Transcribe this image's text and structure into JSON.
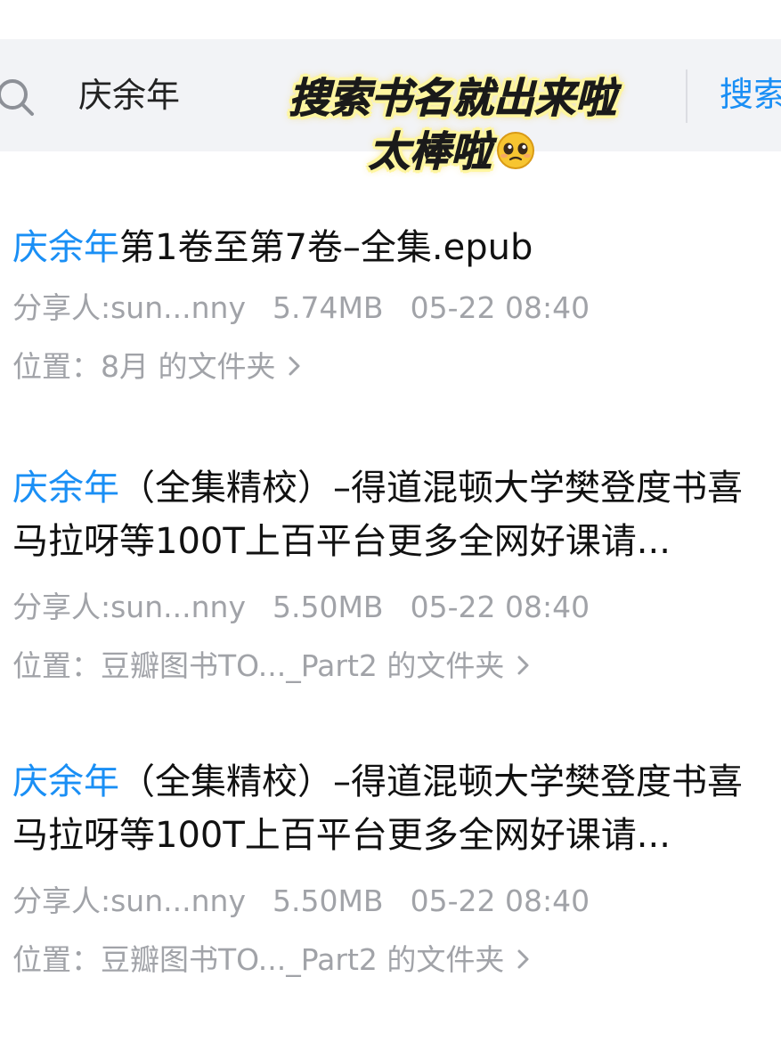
{
  "search": {
    "query": "庆余年",
    "button_label": "搜索"
  },
  "caption": {
    "line1": "搜索书名就出来啦",
    "line2": "太棒啦"
  },
  "results": [
    {
      "title_highlight": "庆余年",
      "title_rest": "第1卷至第7卷–全集.epub",
      "sharer": "分享人:sun...nny",
      "size": "5.74MB",
      "time": "05-22 08:40",
      "location": "位置：8月 的文件夹"
    },
    {
      "title_highlight": "庆余年",
      "title_rest": "（全集精校）–得道混顿大学樊登度书喜马拉呀等100T上百平台更多全网好课请...",
      "sharer": "分享人:sun...nny",
      "size": "5.50MB",
      "time": "05-22 08:40",
      "location": "位置：豆瓣图书TO..._Part2 的文件夹"
    },
    {
      "title_highlight": "庆余年",
      "title_rest": "（全集精校）–得道混顿大学樊登度书喜马拉呀等100T上百平台更多全网好课请...",
      "sharer": "分享人:sun...nny",
      "size": "5.50MB",
      "time": "05-22 08:40",
      "location": "位置：豆瓣图书TO..._Part2 的文件夹"
    }
  ],
  "colors": {
    "accent": "#1a8ff5",
    "meta_text": "#a1a3a8",
    "search_bg": "#f2f3f6"
  },
  "icons": {
    "search": "search-icon",
    "chevron": "chevron-right-icon",
    "emoji": "pleading-face-emoji-icon"
  }
}
